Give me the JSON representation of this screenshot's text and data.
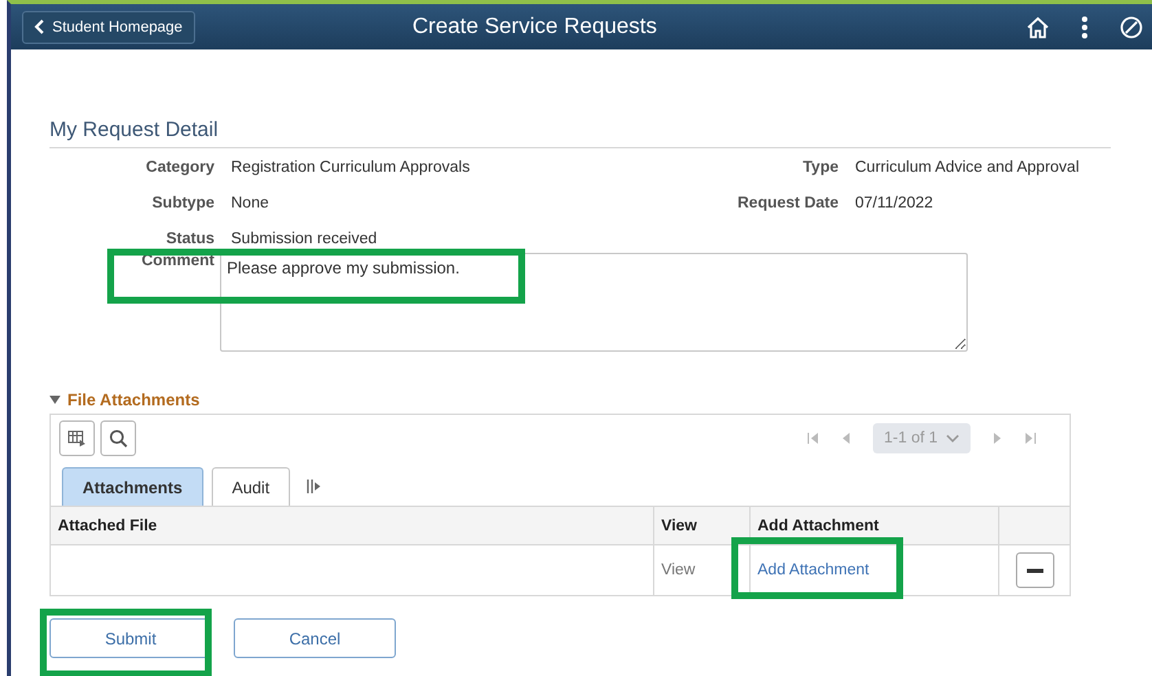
{
  "header": {
    "back_button": "Student Homepage",
    "title": "Create Service Requests"
  },
  "section_title": "My Request Detail",
  "field_rows": [
    {
      "left": {
        "label": "Category",
        "value": "Registration Curriculum Approvals"
      },
      "right": {
        "label": "Type",
        "value": "Curriculum Advice and Approval"
      }
    },
    {
      "left": {
        "label": "Subtype",
        "value": "None"
      },
      "right": {
        "label": "Request Date",
        "value": "07/11/2022"
      }
    },
    {
      "left": {
        "label": "Status",
        "value": "Submission received"
      }
    }
  ],
  "comment": {
    "label": "Comment",
    "value": "Please approve my submission.",
    "highlighted": true
  },
  "attachments": {
    "title": "File Attachments",
    "expanded": true,
    "pager": "1-1 of 1",
    "tabs": [
      {
        "label": "Attachments",
        "selected": true
      },
      {
        "label": "Audit",
        "selected": false
      }
    ],
    "columns": [
      "Attached File",
      "View",
      "Add Attachment"
    ],
    "rows": [
      {
        "view": "View",
        "add_attachment": "Add Attachment",
        "highlighted": true
      }
    ]
  },
  "buttons": [
    {
      "label": "Submit",
      "highlighted": true
    },
    {
      "label": "Cancel",
      "highlighted": false
    }
  ]
}
